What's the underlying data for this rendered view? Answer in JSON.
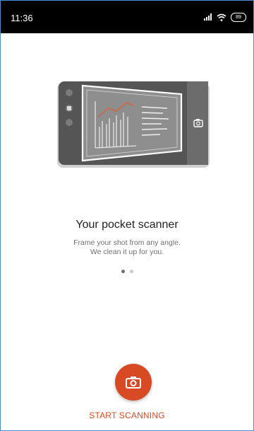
{
  "status_bar": {
    "time": "11:36",
    "battery": "89",
    "icons": [
      "signal-icon",
      "wifi-icon",
      "battery-icon"
    ]
  },
  "onboarding": {
    "title": "Your pocket scanner",
    "subtitle_line1": "Frame your shot from any angle.",
    "subtitle_line2": "We clean it up for you.",
    "page_count": 2,
    "active_page": 1
  },
  "action": {
    "start_label": "START SCANNING",
    "icon": "camera-icon",
    "color": "#d84a24"
  }
}
